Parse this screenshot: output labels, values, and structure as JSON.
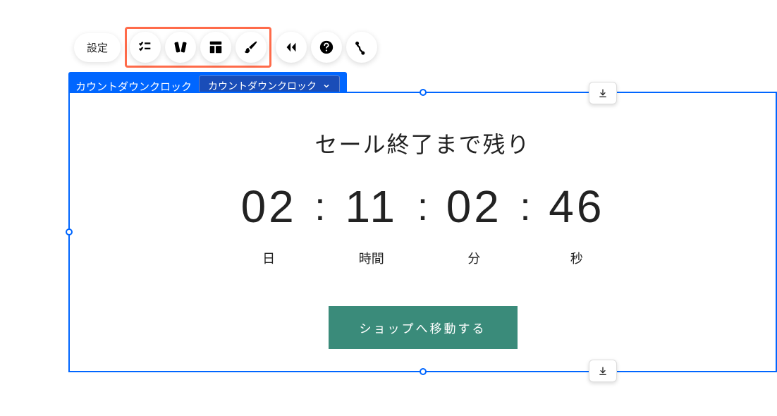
{
  "toolbar": {
    "settings_label": "設定",
    "icons": {
      "animate": "animate-icon",
      "transitions": "transitions-icon",
      "layout": "layout-icon",
      "design": "design-icon",
      "stretch": "stretch-icon",
      "help": "help-icon",
      "more": "more-icon"
    }
  },
  "block": {
    "label": "カウントダウンクロック",
    "dropdown_selected": "カウントダウンクロック"
  },
  "countdown": {
    "title": "セール終了まで残り",
    "days": {
      "value": "02",
      "label": "日"
    },
    "hours": {
      "value": "11",
      "label": "時間"
    },
    "minutes": {
      "value": "02",
      "label": "分"
    },
    "seconds": {
      "value": "46",
      "label": "秒"
    },
    "separator": ":",
    "cta_label": "ショップへ移動する"
  },
  "colors": {
    "primary": "#0066ff",
    "highlight": "#ff6b4a",
    "cta": "#3a8b7a"
  }
}
